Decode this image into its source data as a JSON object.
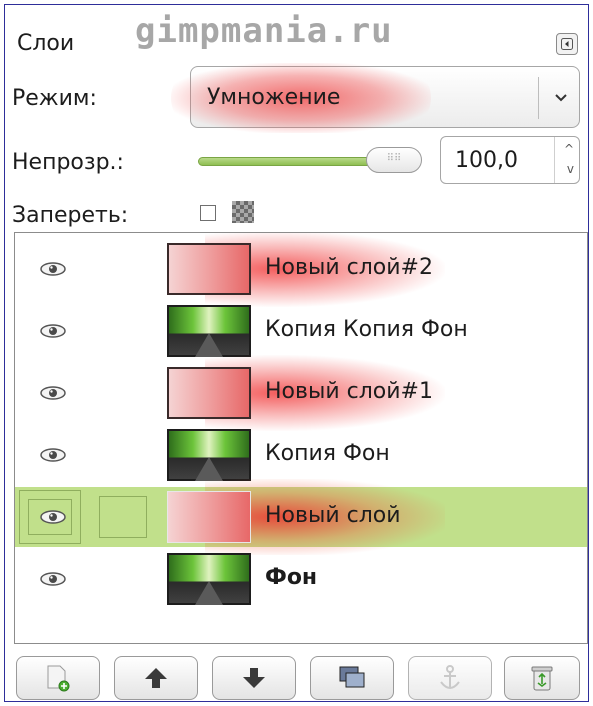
{
  "panel": {
    "title": "Слои",
    "watermark": "gimpmania.ru"
  },
  "mode": {
    "label": "Режим:",
    "value": "Умножение"
  },
  "opacity": {
    "label": "Непрозр.:",
    "value": "100,0",
    "percent": 100
  },
  "lock": {
    "label": "Запереть:"
  },
  "layers": [
    {
      "name": "Новый слой#2",
      "thumbnail": "red-gradient",
      "visible": true,
      "selected": false,
      "bold": false
    },
    {
      "name": "Копия Копия Фон",
      "thumbnail": "road-photo",
      "visible": true,
      "selected": false,
      "bold": false
    },
    {
      "name": "Новый слой#1",
      "thumbnail": "red-gradient",
      "visible": true,
      "selected": false,
      "bold": false
    },
    {
      "name": "Копия Фон",
      "thumbnail": "road-photo",
      "visible": true,
      "selected": false,
      "bold": false
    },
    {
      "name": "Новый слой",
      "thumbnail": "red-gradient",
      "visible": true,
      "selected": true,
      "bold": false
    },
    {
      "name": "Фон",
      "thumbnail": "road-photo",
      "visible": true,
      "selected": false,
      "bold": true
    }
  ],
  "toolbar": [
    {
      "icon": "new-layer-icon"
    },
    {
      "icon": "arrow-up-icon"
    },
    {
      "icon": "arrow-down-icon"
    },
    {
      "icon": "duplicate-layer-icon"
    },
    {
      "icon": "anchor-icon"
    },
    {
      "icon": "trash-icon"
    }
  ],
  "colors": {
    "selection": "#c1e08b",
    "highlight": "#f03c3c",
    "slider": "#8fbf52"
  }
}
